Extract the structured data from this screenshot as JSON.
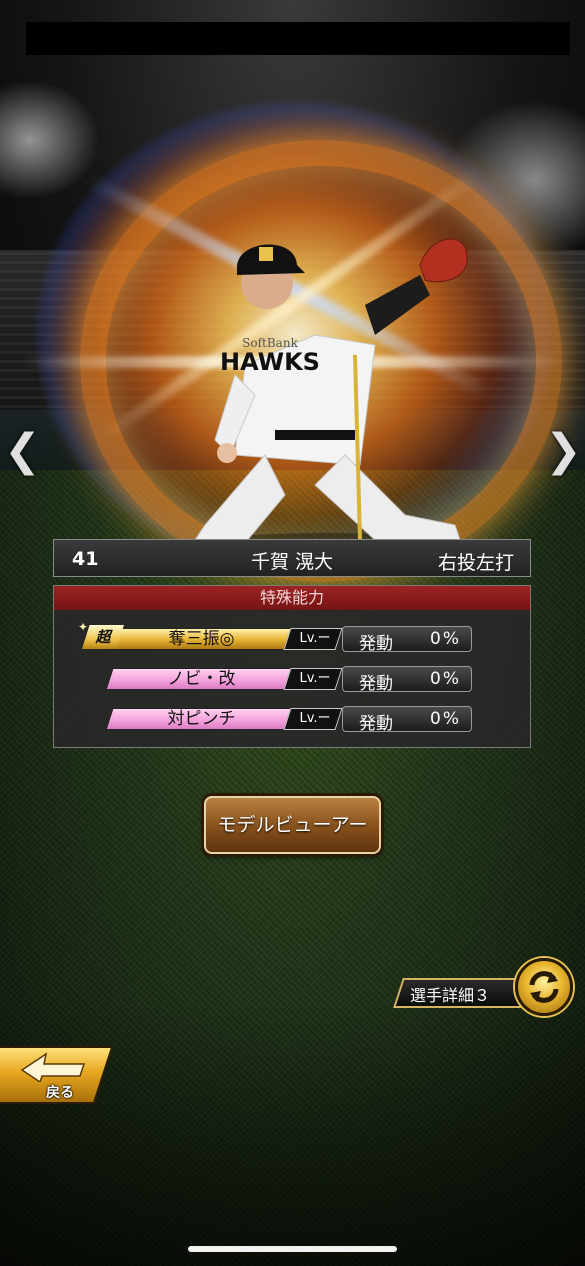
{
  "player": {
    "number": "41",
    "name": "千賀 滉大",
    "handedness": "右投左打"
  },
  "navigation": {
    "prev_icon": "chevron-left-icon",
    "next_icon": "chevron-right-icon",
    "prev_glyph": "❮",
    "next_glyph": "❯"
  },
  "abilities": {
    "header": "特殊能力",
    "items": [
      {
        "badge": "超",
        "name": "奪三振◎",
        "level": "Lv.ー",
        "activation_label": "発動",
        "activation_value": "0%",
        "style": "gold"
      },
      {
        "badge": "",
        "name": "ノビ・改",
        "level": "Lv.ー",
        "activation_label": "発動",
        "activation_value": "0%",
        "style": "pink"
      },
      {
        "badge": "",
        "name": "対ピンチ",
        "level": "Lv.ー",
        "activation_label": "発動",
        "activation_value": "0%",
        "style": "pink"
      }
    ]
  },
  "buttons": {
    "model_viewer": "モデルビューアー",
    "player_detail": "選手詳細３",
    "back": "戻る"
  },
  "colors": {
    "ability_header": "#9d2323",
    "gold_ability": "#e9b83a",
    "pink_ability": "#f4a3dc",
    "model_button": "#8a531e"
  }
}
